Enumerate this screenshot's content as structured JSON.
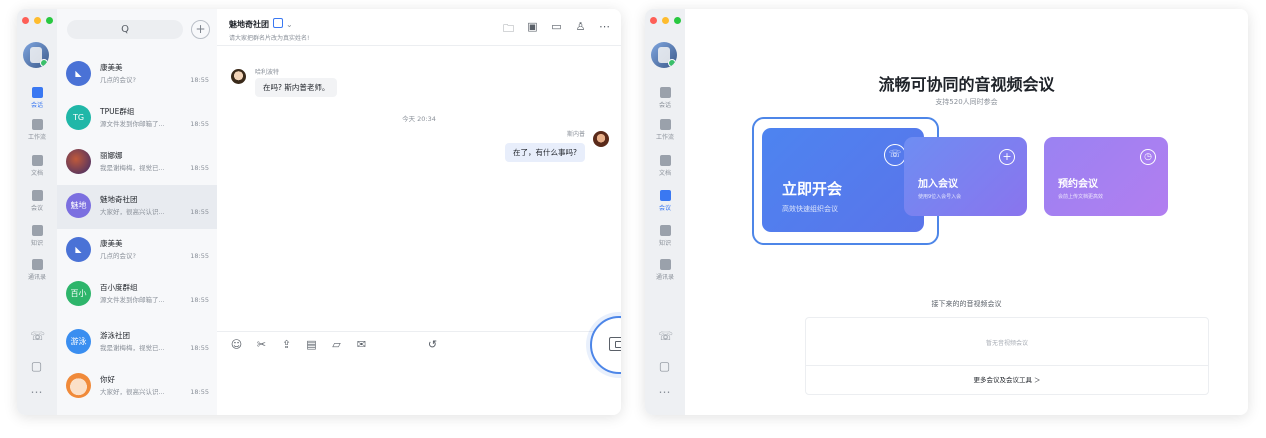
{
  "left_window": {
    "nav": [
      {
        "label": "会话",
        "icon": "chat-icon",
        "active": true
      },
      {
        "label": "工作流",
        "icon": "workflow-icon",
        "active": false
      },
      {
        "label": "文档",
        "icon": "doc-icon",
        "active": false
      },
      {
        "label": "会议",
        "icon": "meeting-icon",
        "active": false
      },
      {
        "label": "知识",
        "icon": "knowledge-icon",
        "active": false
      },
      {
        "label": "通讯录",
        "icon": "contacts-icon",
        "active": false
      }
    ],
    "search": {
      "icon": "Q"
    },
    "conversations": [
      {
        "name": "康美美",
        "preview": "几点的会议?",
        "time": "18:55",
        "avatar_text": "",
        "color": "#4a72d6"
      },
      {
        "name": "TPUE群组",
        "preview": "源文件发到你邮箱了...",
        "time": "18:55",
        "avatar_text": "TG",
        "color": "#20b7a8"
      },
      {
        "name": "丽娜娜",
        "preview": "我是谢梅梅，视觉已...",
        "time": "18:55",
        "avatar_text": "",
        "color": "#6b3a2c"
      },
      {
        "name": "魅地奇社团",
        "preview": "大家好，很高兴认识...",
        "time": "18:55",
        "avatar_text": "魅地",
        "color": "#7b6fe0"
      },
      {
        "name": "康美美",
        "preview": "几点的会议?",
        "time": "18:55",
        "avatar_text": "",
        "color": "#4a72d6"
      },
      {
        "name": "百小度群组",
        "preview": "源文件发到你邮箱了...",
        "time": "18:55",
        "avatar_text": "百小",
        "color": "#2eb56b"
      },
      {
        "name": "游泳社团",
        "preview": "我是谢梅梅，视觉已...",
        "time": "18:55",
        "avatar_text": "游泳",
        "color": "#3a8ef0"
      },
      {
        "name": "你好",
        "preview": "大家好，很高兴认识...",
        "time": "18:55",
        "avatar_text": "",
        "color": "#f08a3a"
      }
    ],
    "chat": {
      "title": "魅地奇社团",
      "subtitle": "请大家把群名片改为真实姓名!",
      "messages": [
        {
          "sender": "哈利波特",
          "text": "在吗? 斯内普老师。",
          "me": false
        },
        {
          "sender": "斯内普",
          "text": "在了，有什么事吗?",
          "me": true
        }
      ],
      "time_divider": "今天 20:34"
    }
  },
  "right_window": {
    "title": "流畅可协同的音视频会议",
    "subtitle": "支持520人同时参会",
    "cards": [
      {
        "title": "立即开会",
        "desc": "高效快速组织会议",
        "icon": "phone-cloud-icon"
      },
      {
        "title": "加入会议",
        "desc": "使用9位入会号入会",
        "icon": "plus-icon"
      },
      {
        "title": "预约会议",
        "desc": "会前上传文档更高效",
        "icon": "clock-icon"
      }
    ],
    "upcoming_title": "接下来的的音视频会议",
    "no_meeting": "暂无音视频会议",
    "more_tools": "更多会议及会议工具 ＞"
  }
}
